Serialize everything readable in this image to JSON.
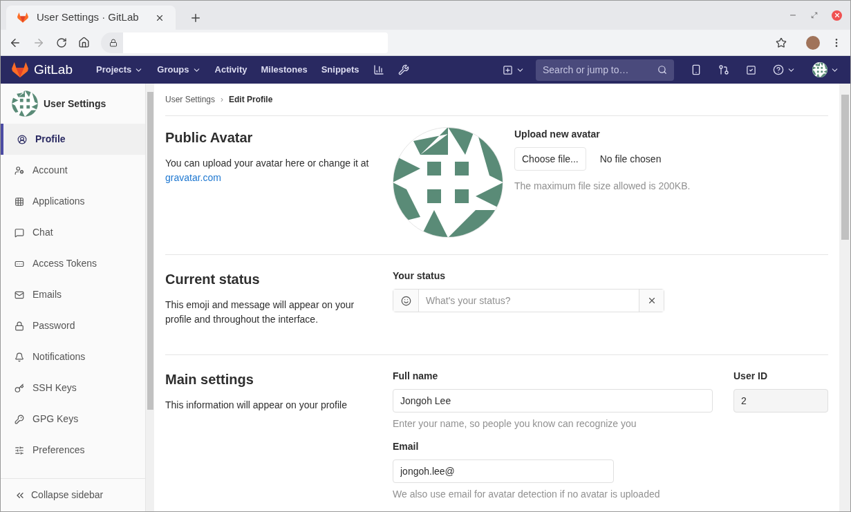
{
  "browser": {
    "tab_title": "User Settings · GitLab"
  },
  "navbar": {
    "brand": "GitLab",
    "links": [
      {
        "label": "Projects",
        "dropdown": true
      },
      {
        "label": "Groups",
        "dropdown": true
      },
      {
        "label": "Activity",
        "dropdown": false
      },
      {
        "label": "Milestones",
        "dropdown": false
      },
      {
        "label": "Snippets",
        "dropdown": false
      }
    ],
    "search_placeholder": "Search or jump to…"
  },
  "sidebar": {
    "title": "User Settings",
    "items": [
      {
        "label": "Profile",
        "selected": true
      },
      {
        "label": "Account",
        "selected": false
      },
      {
        "label": "Applications",
        "selected": false
      },
      {
        "label": "Chat",
        "selected": false
      },
      {
        "label": "Access Tokens",
        "selected": false
      },
      {
        "label": "Emails",
        "selected": false
      },
      {
        "label": "Password",
        "selected": false
      },
      {
        "label": "Notifications",
        "selected": false
      },
      {
        "label": "SSH Keys",
        "selected": false
      },
      {
        "label": "GPG Keys",
        "selected": false
      },
      {
        "label": "Preferences",
        "selected": false
      }
    ],
    "collapse": "Collapse sidebar"
  },
  "breadcrumb": [
    "User Settings",
    "Edit Profile"
  ],
  "breadcrumb_separator": "›",
  "avatar_section": {
    "title": "Public Avatar",
    "description": "You can upload your avatar here or change it at",
    "link": "gravatar.com",
    "upload_label": "Upload new avatar",
    "choose_button": "Choose file...",
    "file_status": "No file chosen",
    "hint": "The maximum file size allowed is 200KB."
  },
  "status_section": {
    "title": "Current status",
    "description": "This emoji and message will appear on your profile and throughout the interface.",
    "label": "Your status",
    "placeholder": "What's your status?"
  },
  "main_section": {
    "title": "Main settings",
    "description": "This information will appear on your profile",
    "full_name": {
      "label": "Full name",
      "value": "Jongoh Lee",
      "hint": "Enter your name, so people you know can recognize you"
    },
    "user_id": {
      "label": "User ID",
      "value": "2"
    },
    "email": {
      "label": "Email",
      "value": "jongoh.lee@",
      "hint": "We also use email for avatar detection if no avatar is uploaded"
    }
  }
}
